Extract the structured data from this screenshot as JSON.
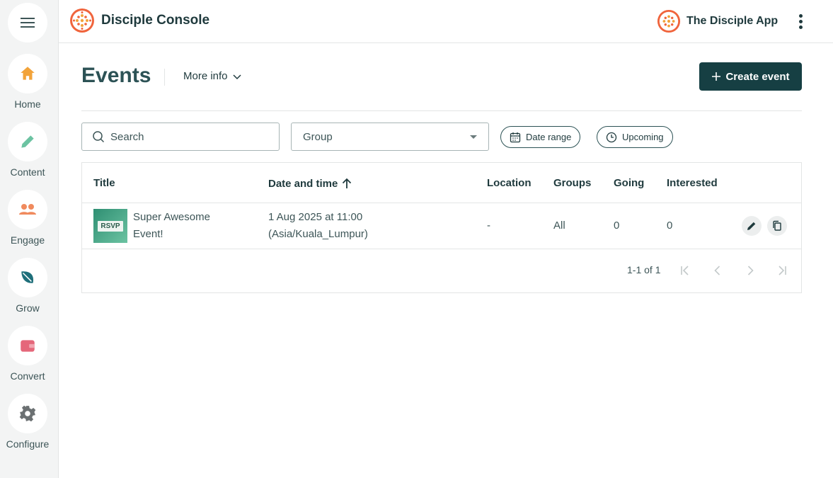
{
  "sidebar": {
    "menu_icon": "hamburger-icon",
    "items": [
      {
        "label": "Home",
        "icon": "home-icon",
        "color": "#f2a33a"
      },
      {
        "label": "Content",
        "icon": "pencil-icon",
        "color": "#6cc3a2"
      },
      {
        "label": "Engage",
        "icon": "people-icon",
        "color": "#f08a5d"
      },
      {
        "label": "Grow",
        "icon": "leaf-icon",
        "color": "#1f6f7a"
      },
      {
        "label": "Convert",
        "icon": "wallet-icon",
        "color": "#e5677a"
      },
      {
        "label": "Configure",
        "icon": "gear-icon",
        "color": "#6b7072"
      }
    ]
  },
  "header": {
    "brand_title": "Disciple Console",
    "app_name": "The Disciple App",
    "logo_color": "#f0643c"
  },
  "page": {
    "title": "Events",
    "more_info_label": "More info",
    "create_label": "Create event",
    "accent": "#163f43"
  },
  "filters": {
    "search_placeholder": "Search",
    "group_label": "Group",
    "date_range_label": "Date range",
    "upcoming_label": "Upcoming"
  },
  "table": {
    "headers": {
      "title": "Title",
      "date": "Date and time",
      "location": "Location",
      "groups": "Groups",
      "going": "Going",
      "interested": "Interested"
    },
    "rows": [
      {
        "thumb_text": "RSVP",
        "title_line1": "Super Awesome",
        "title_line2": "Event!",
        "date_line1": "1 Aug 2025 at 11:00",
        "date_line2": "(Asia/Kuala_Lumpur)",
        "location": "-",
        "groups": "All",
        "going": "0",
        "interested": "0"
      }
    ],
    "pagination": "1-1 of 1"
  }
}
